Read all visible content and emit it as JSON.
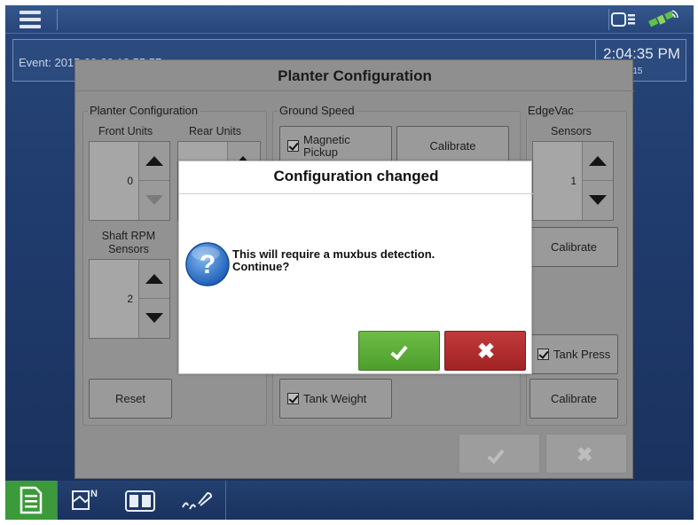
{
  "topbar": {
    "menu_icon": "hamburger-menu-icon",
    "status_icons": [
      "display-toggle-icon",
      "gps-satellite-icon"
    ]
  },
  "event_bar": {
    "event_text": "Event: 2015-09-29 13:55:57",
    "clock": "2:04:35 PM",
    "date": "9/29/2015"
  },
  "planter_config": {
    "title": "Planter Configuration",
    "planter_group": {
      "title": "Planter Configuration",
      "front_units_label": "Front Units",
      "front_units_value": "0",
      "rear_units_label": "Rear Units",
      "shaft_rpm_label": "Shaft RPM\nSensors",
      "shaft_rpm_value": "2",
      "reset_label": "Reset"
    },
    "ground_speed": {
      "title": "Ground Speed",
      "magnetic_pickup_label": "Magnetic\nPickup",
      "magnetic_pickup_checked": true,
      "calibrate_label": "Calibrate",
      "tank_weight_label": "Tank Weight",
      "tank_weight_checked": true
    },
    "edgevac": {
      "title": "EdgeVac",
      "sensors_label": "Sensors",
      "sensors_value": "1",
      "calibrate_label": "Calibrate",
      "tank_press_label": "Tank Press",
      "tank_press_checked": true,
      "calibrate2_label": "Calibrate"
    }
  },
  "dialog": {
    "title": "Configuration changed",
    "message": "This will require a muxbus detection.\nContinue?",
    "icon": "question-icon",
    "ok_icon": "checkmark-icon",
    "cancel_icon": "x-icon",
    "cancel_glyph": "✖"
  },
  "bottom_nav": {
    "items": [
      "run-page-icon",
      "field-map-icon",
      "split-view-icon",
      "planter-setup-icon"
    ]
  },
  "colors": {
    "ok_green": "#5aaa36",
    "cancel_red": "#b02c2c",
    "screen_blue": "#1f3a6c",
    "nav_active_green": "#3c9a3a"
  }
}
